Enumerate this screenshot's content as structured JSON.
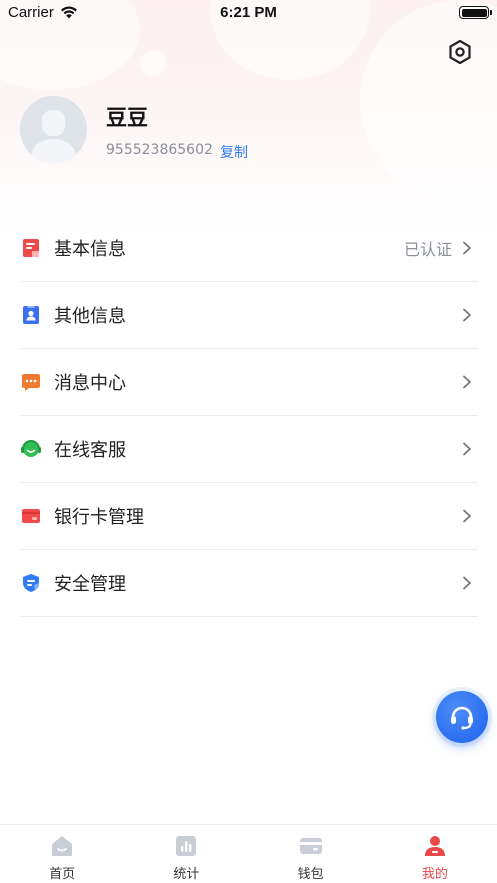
{
  "status_bar": {
    "carrier": "Carrier",
    "time": "6:21 PM"
  },
  "profile": {
    "name": "豆豆",
    "user_id": "955523865602",
    "copy_label": "复制"
  },
  "menu": [
    {
      "label": "基本信息",
      "status": "已认证",
      "icon": "document-icon"
    },
    {
      "label": "其他信息",
      "status": "",
      "icon": "id-card-icon"
    },
    {
      "label": "消息中心",
      "status": "",
      "icon": "message-icon"
    },
    {
      "label": "在线客服",
      "status": "",
      "icon": "headset-icon"
    },
    {
      "label": "银行卡管理",
      "status": "",
      "icon": "bank-card-icon"
    },
    {
      "label": "安全管理",
      "status": "",
      "icon": "shield-icon"
    }
  ],
  "tabs": [
    {
      "label": "首页",
      "icon": "home-icon",
      "active": false
    },
    {
      "label": "统计",
      "icon": "stats-icon",
      "active": false
    },
    {
      "label": "钱包",
      "icon": "wallet-icon",
      "active": false
    },
    {
      "label": "我的",
      "icon": "user-icon",
      "active": true
    }
  ],
  "colors": {
    "accent_red": "#e84a4a",
    "link_blue": "#2f7cf6",
    "fab_blue": "#2a6ef0",
    "tab_inactive": "#c9ced6"
  }
}
